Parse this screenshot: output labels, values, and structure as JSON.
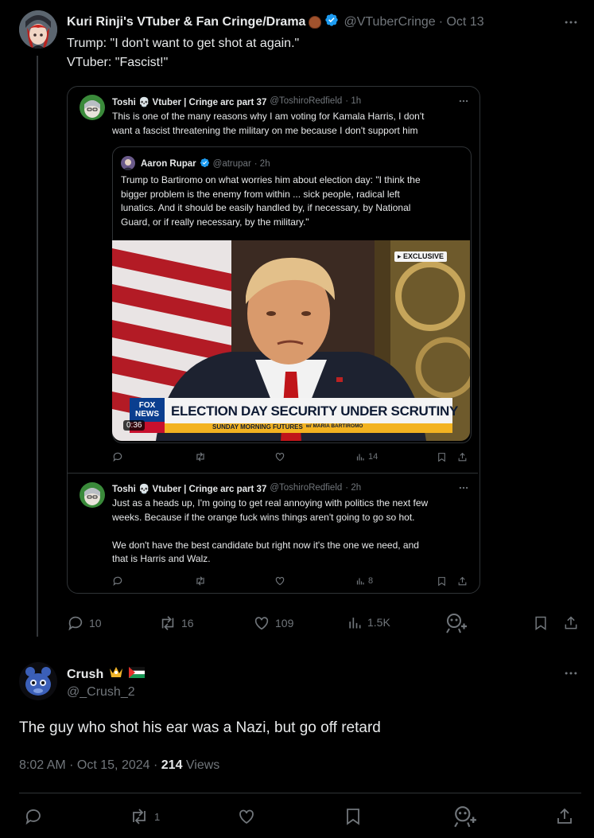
{
  "main_tweet": {
    "display_name": "Kuri Rinji's VTuber & Fan Cringe/Drama",
    "handle": "@VTuberCringe",
    "date": "· Oct 13",
    "text_line1": "Trump: \"I don't want to get shot at again.\"",
    "text_line2": "VTuber: \"Fascist!\"",
    "replies": "10",
    "reposts": "16",
    "likes": "109",
    "views": "1.5K"
  },
  "quote1": {
    "display_name": "Toshi 💀 Vtuber | Cringe arc part 37",
    "handle": "@ToshiroRedfield",
    "time": "· 1h",
    "text_line1": "This is one of the many reasons why I am voting for Kamala Harris, I don't",
    "text_line2": "want a fascist threatening the military on me because I don't support him",
    "views": "14"
  },
  "nested_quote": {
    "display_name": "Aaron Rupar",
    "handle": "@atrupar",
    "time": "· 2h",
    "lines": [
      "Trump to Bartiromo on what worries him about election day: \"I think the",
      "bigger problem is the enemy from within ... sick people, radical left",
      "lunatics. And it should be easily handled by, if necessary, by National",
      "Guard, or if really necessary, by the military.\""
    ],
    "video": {
      "badge": "▸ EXCLUSIVE",
      "chyron": "ELECTION DAY SECURITY UNDER SCRUTINY",
      "subchyron": "SUNDAY MORNING FUTURES",
      "host": "w/ MARIA BARTIROMO",
      "network": "FOX NEWS",
      "duration": "0:36"
    }
  },
  "quote2": {
    "display_name": "Toshi 💀 Vtuber | Cringe arc part 37",
    "handle": "@ToshiroRedfield",
    "time": "· 2h",
    "lines": [
      "Just as a heads up, I'm going to get real annoying with politics the next few",
      "weeks. Because if the orange fuck wins things aren't going to go so hot.",
      "",
      "We don't have the best candidate but right now it's the one we need, and",
      "that is Harris and Walz."
    ],
    "views": "8"
  },
  "reply_tweet": {
    "display_name": "Crush",
    "handle": "@_Crush_2",
    "text": "The guy who shot his ear was a Nazi, but go off retard",
    "timestamp": "8:02 AM · Oct 15, 2024 · ",
    "views_count": "214",
    "views_label": " Views",
    "reposts": "1"
  },
  "colors": {
    "background": "#000000",
    "text": "#e7e9ea",
    "muted": "#71767b",
    "verified": "#1d9bf0",
    "border": "#2f3336"
  }
}
